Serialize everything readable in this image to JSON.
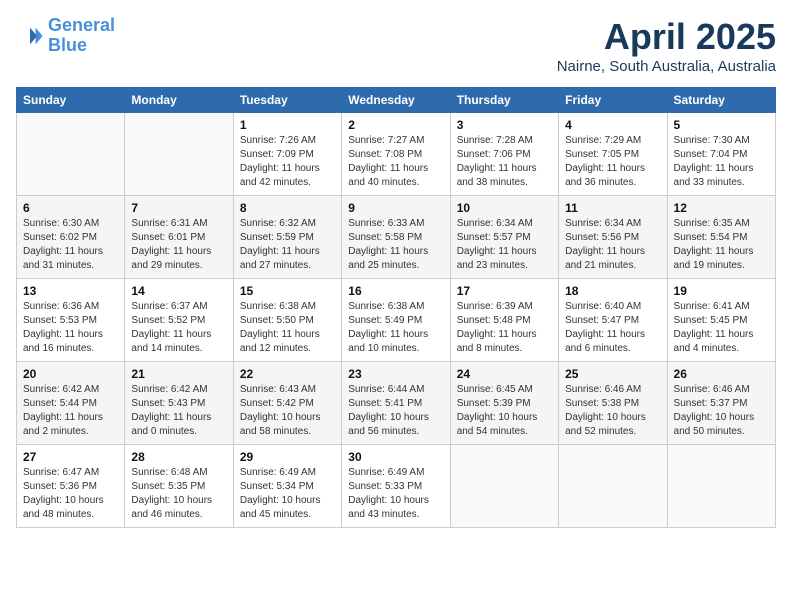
{
  "logo": {
    "line1": "General",
    "line2": "Blue"
  },
  "header": {
    "month": "April 2025",
    "location": "Nairne, South Australia, Australia"
  },
  "weekdays": [
    "Sunday",
    "Monday",
    "Tuesday",
    "Wednesday",
    "Thursday",
    "Friday",
    "Saturday"
  ],
  "weeks": [
    [
      null,
      null,
      {
        "day": 1,
        "sunrise": "7:26 AM",
        "sunset": "7:09 PM",
        "daylight": "11 hours and 42 minutes."
      },
      {
        "day": 2,
        "sunrise": "7:27 AM",
        "sunset": "7:08 PM",
        "daylight": "11 hours and 40 minutes."
      },
      {
        "day": 3,
        "sunrise": "7:28 AM",
        "sunset": "7:06 PM",
        "daylight": "11 hours and 38 minutes."
      },
      {
        "day": 4,
        "sunrise": "7:29 AM",
        "sunset": "7:05 PM",
        "daylight": "11 hours and 36 minutes."
      },
      {
        "day": 5,
        "sunrise": "7:30 AM",
        "sunset": "7:04 PM",
        "daylight": "11 hours and 33 minutes."
      }
    ],
    [
      {
        "day": 6,
        "sunrise": "6:30 AM",
        "sunset": "6:02 PM",
        "daylight": "11 hours and 31 minutes."
      },
      {
        "day": 7,
        "sunrise": "6:31 AM",
        "sunset": "6:01 PM",
        "daylight": "11 hours and 29 minutes."
      },
      {
        "day": 8,
        "sunrise": "6:32 AM",
        "sunset": "5:59 PM",
        "daylight": "11 hours and 27 minutes."
      },
      {
        "day": 9,
        "sunrise": "6:33 AM",
        "sunset": "5:58 PM",
        "daylight": "11 hours and 25 minutes."
      },
      {
        "day": 10,
        "sunrise": "6:34 AM",
        "sunset": "5:57 PM",
        "daylight": "11 hours and 23 minutes."
      },
      {
        "day": 11,
        "sunrise": "6:34 AM",
        "sunset": "5:56 PM",
        "daylight": "11 hours and 21 minutes."
      },
      {
        "day": 12,
        "sunrise": "6:35 AM",
        "sunset": "5:54 PM",
        "daylight": "11 hours and 19 minutes."
      }
    ],
    [
      {
        "day": 13,
        "sunrise": "6:36 AM",
        "sunset": "5:53 PM",
        "daylight": "11 hours and 16 minutes."
      },
      {
        "day": 14,
        "sunrise": "6:37 AM",
        "sunset": "5:52 PM",
        "daylight": "11 hours and 14 minutes."
      },
      {
        "day": 15,
        "sunrise": "6:38 AM",
        "sunset": "5:50 PM",
        "daylight": "11 hours and 12 minutes."
      },
      {
        "day": 16,
        "sunrise": "6:38 AM",
        "sunset": "5:49 PM",
        "daylight": "11 hours and 10 minutes."
      },
      {
        "day": 17,
        "sunrise": "6:39 AM",
        "sunset": "5:48 PM",
        "daylight": "11 hours and 8 minutes."
      },
      {
        "day": 18,
        "sunrise": "6:40 AM",
        "sunset": "5:47 PM",
        "daylight": "11 hours and 6 minutes."
      },
      {
        "day": 19,
        "sunrise": "6:41 AM",
        "sunset": "5:45 PM",
        "daylight": "11 hours and 4 minutes."
      }
    ],
    [
      {
        "day": 20,
        "sunrise": "6:42 AM",
        "sunset": "5:44 PM",
        "daylight": "11 hours and 2 minutes."
      },
      {
        "day": 21,
        "sunrise": "6:42 AM",
        "sunset": "5:43 PM",
        "daylight": "11 hours and 0 minutes."
      },
      {
        "day": 22,
        "sunrise": "6:43 AM",
        "sunset": "5:42 PM",
        "daylight": "10 hours and 58 minutes."
      },
      {
        "day": 23,
        "sunrise": "6:44 AM",
        "sunset": "5:41 PM",
        "daylight": "10 hours and 56 minutes."
      },
      {
        "day": 24,
        "sunrise": "6:45 AM",
        "sunset": "5:39 PM",
        "daylight": "10 hours and 54 minutes."
      },
      {
        "day": 25,
        "sunrise": "6:46 AM",
        "sunset": "5:38 PM",
        "daylight": "10 hours and 52 minutes."
      },
      {
        "day": 26,
        "sunrise": "6:46 AM",
        "sunset": "5:37 PM",
        "daylight": "10 hours and 50 minutes."
      }
    ],
    [
      {
        "day": 27,
        "sunrise": "6:47 AM",
        "sunset": "5:36 PM",
        "daylight": "10 hours and 48 minutes."
      },
      {
        "day": 28,
        "sunrise": "6:48 AM",
        "sunset": "5:35 PM",
        "daylight": "10 hours and 46 minutes."
      },
      {
        "day": 29,
        "sunrise": "6:49 AM",
        "sunset": "5:34 PM",
        "daylight": "10 hours and 45 minutes."
      },
      {
        "day": 30,
        "sunrise": "6:49 AM",
        "sunset": "5:33 PM",
        "daylight": "10 hours and 43 minutes."
      },
      null,
      null,
      null
    ]
  ]
}
